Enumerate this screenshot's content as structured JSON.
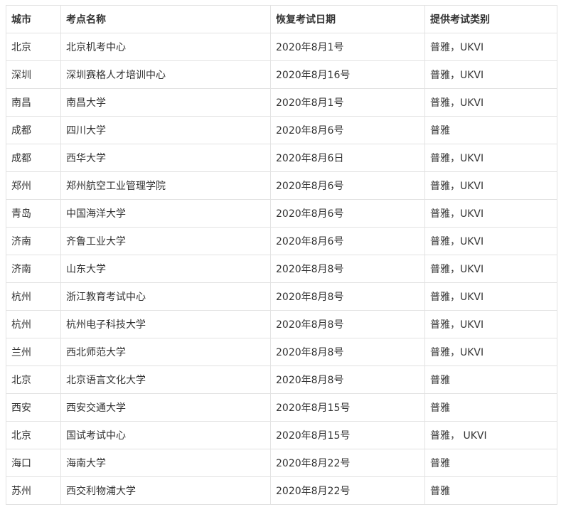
{
  "table": {
    "headers": [
      "城市",
      "考点名称",
      "恢复考试日期",
      "提供考试类别"
    ],
    "rows": [
      [
        "北京",
        "北京机考中心",
        "2020年8月1号",
        "普雅，UKVI"
      ],
      [
        "深圳",
        "深圳赛格人才培训中心",
        "2020年8月16号",
        "普雅，UKVI"
      ],
      [
        "南昌",
        "南昌大学",
        "2020年8月1号",
        "普雅，UKVI"
      ],
      [
        "成都",
        "四川大学",
        "2020年8月6号",
        "普雅"
      ],
      [
        "成都",
        "西华大学",
        "2020年8月6日",
        "普雅，UKVI"
      ],
      [
        "郑州",
        "郑州航空工业管理学院",
        "2020年8月6号",
        "普雅，UKVI"
      ],
      [
        "青岛",
        "中国海洋大学",
        "2020年8月6号",
        "普雅，UKVI"
      ],
      [
        "济南",
        "齐鲁工业大学",
        "2020年8月6号",
        "普雅，UKVI"
      ],
      [
        "济南",
        "山东大学",
        "2020年8月8号",
        "普雅，UKVI"
      ],
      [
        "杭州",
        "浙江教育考试中心",
        "2020年8月8号",
        "普雅，UKVI"
      ],
      [
        "杭州",
        "杭州电子科技大学",
        "2020年8月8号",
        "普雅，UKVI"
      ],
      [
        "兰州",
        "西北师范大学",
        "2020年8月8号",
        "普雅，UKVI"
      ],
      [
        "北京",
        "北京语言文化大学",
        "2020年8月8号",
        "普雅"
      ],
      [
        "西安",
        "西安交通大学",
        "2020年8月15号",
        "普雅"
      ],
      [
        "北京",
        "国试考试中心",
        "2020年8月15号",
        "普雅， UKVI"
      ],
      [
        "海口",
        "海南大学",
        "2020年8月22号",
        "普雅"
      ],
      [
        "苏州",
        "西交利物浦大学",
        "2020年8月22号",
        "普雅"
      ]
    ]
  }
}
